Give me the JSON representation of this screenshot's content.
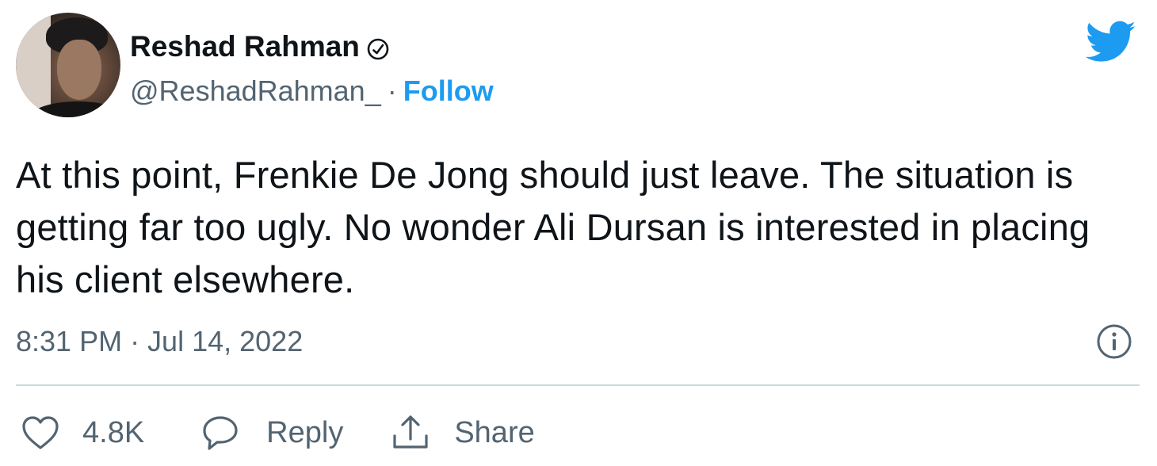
{
  "author": {
    "display_name": "Reshad Rahman",
    "handle": "@ReshadRahman_",
    "separator": "·",
    "follow_label": "Follow"
  },
  "tweet": {
    "text": "At this point, Frenkie De Jong should just leave. The situation is getting far too ugly. No wonder Ali Dursan is interested in placing his client elsewhere.",
    "timestamp": "8:31 PM · Jul 14, 2022"
  },
  "actions": {
    "like_count": "4.8K",
    "reply_label": "Reply",
    "share_label": "Share"
  },
  "icons": {
    "brand": "twitter-bird-icon",
    "verified": "verified-badge-icon",
    "info": "info-icon",
    "like": "heart-icon",
    "reply": "speech-bubble-icon",
    "share": "share-upload-icon"
  },
  "colors": {
    "brand_blue": "#1d9bf0",
    "text_primary": "#0f1419",
    "text_secondary": "#536471",
    "divider": "#cfd9de"
  }
}
